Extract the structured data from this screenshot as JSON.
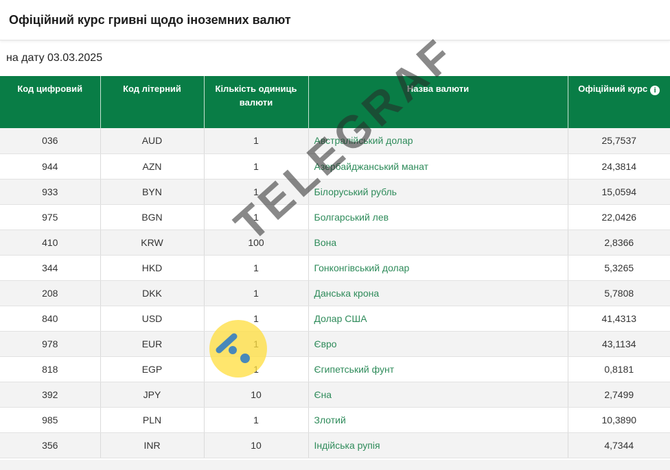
{
  "header": {
    "title": "Офіційний курс гривні щодо іноземних валют"
  },
  "date_label": "на дату 03.03.2025",
  "table": {
    "columns": {
      "code_num": "Код цифровий",
      "code_alpha": "Код літерний",
      "units": "Кількість одиниць валюти",
      "name": "Назва валюти",
      "rate": "Офіційний курс"
    },
    "rows": [
      {
        "code_num": "036",
        "code_alpha": "AUD",
        "units": "1",
        "name": "Австралійський долар",
        "rate": "25,7537"
      },
      {
        "code_num": "944",
        "code_alpha": "AZN",
        "units": "1",
        "name": "Азербайджанський манат",
        "rate": "24,3814"
      },
      {
        "code_num": "933",
        "code_alpha": "BYN",
        "units": "1",
        "name": "Білоруський рубль",
        "rate": "15,0594"
      },
      {
        "code_num": "975",
        "code_alpha": "BGN",
        "units": "1",
        "name": "Болгарський лев",
        "rate": "22,0426"
      },
      {
        "code_num": "410",
        "code_alpha": "KRW",
        "units": "100",
        "name": "Вона",
        "rate": "2,8366"
      },
      {
        "code_num": "344",
        "code_alpha": "HKD",
        "units": "1",
        "name": "Гонконгівський долар",
        "rate": "5,3265"
      },
      {
        "code_num": "208",
        "code_alpha": "DKK",
        "units": "1",
        "name": "Данська крона",
        "rate": "5,7808"
      },
      {
        "code_num": "840",
        "code_alpha": "USD",
        "units": "1",
        "name": "Долар США",
        "rate": "41,4313"
      },
      {
        "code_num": "978",
        "code_alpha": "EUR",
        "units": "1",
        "name": "Євро",
        "rate": "43,1134"
      },
      {
        "code_num": "818",
        "code_alpha": "EGP",
        "units": "1",
        "name": "Єгипетський фунт",
        "rate": "0,8181"
      },
      {
        "code_num": "392",
        "code_alpha": "JPY",
        "units": "10",
        "name": "Єна",
        "rate": "2,7499"
      },
      {
        "code_num": "985",
        "code_alpha": "PLN",
        "units": "1",
        "name": "Злотий",
        "rate": "10,3890"
      },
      {
        "code_num": "356",
        "code_alpha": "INR",
        "units": "10",
        "name": "Індійська рупія",
        "rate": "4,7344"
      }
    ]
  },
  "watermark": {
    "text": "TELEGRAF"
  },
  "icons": {
    "rate_info": "info-icon",
    "watermark_logo": "telegraf-logo"
  },
  "colors": {
    "header_green": "#097d46",
    "link_green": "#2e8b5a",
    "watermark_yellow": "#ffdd3c"
  }
}
